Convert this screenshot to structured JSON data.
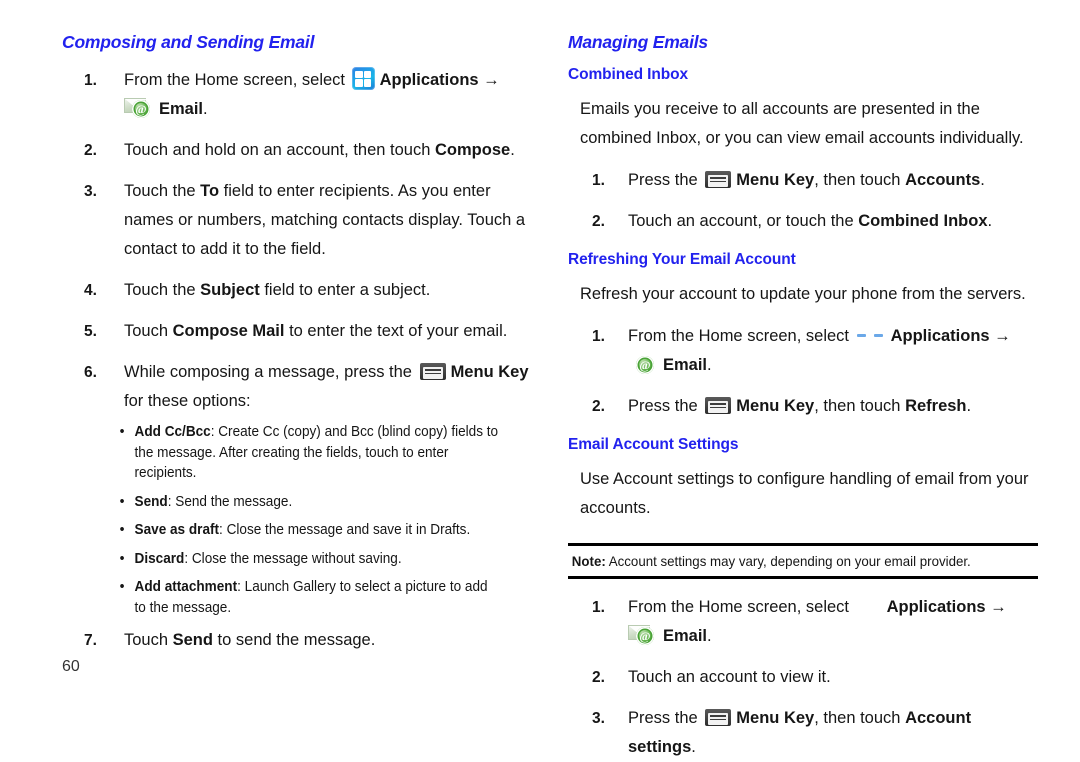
{
  "page_number": "60",
  "colors": {
    "heading_blue": "#2222ee",
    "body_text": "#161616",
    "rule_black": "#000000"
  },
  "icons": {
    "applications": "applications-grid-icon",
    "applications_faded": "applications-grid-icon-faded",
    "applications_missing": "applications-grid-icon-missing",
    "email": "email-envelope-at-icon",
    "email_no_envelope": "email-at-icon",
    "menu_key": "menu-key-icon",
    "arrow": "→",
    "bullet": "•"
  },
  "left_column": {
    "section_title": "Composing and Sending Email",
    "steps": [
      {
        "num": "1.",
        "pre": "From the Home screen, select ",
        "app_label": "Applications",
        "mid": "",
        "email_label": "Email",
        "post": "."
      },
      {
        "num": "2.",
        "pre": "Touch and hold on an account, then touch ",
        "bold": "Compose",
        "post": "."
      },
      {
        "num": "3.",
        "pre": "Touch the ",
        "bold": "To",
        "post": " field to enter recipients. As you enter names or numbers, matching contacts display. Touch a contact to add it to the field."
      },
      {
        "num": "4.",
        "pre": "Touch the ",
        "bold": "Subject",
        "post": " field to enter a subject."
      },
      {
        "num": "5.",
        "pre": "Touch ",
        "bold": "Compose Mail",
        "post": " to enter the text of your email."
      },
      {
        "num": "6.",
        "pre": "While composing a message, press the ",
        "bold": "Menu Key",
        "post": " for these options:"
      },
      {
        "num": "7.",
        "pre": "Touch ",
        "bold": "Send",
        "post": " to send the message."
      }
    ],
    "bullets": [
      {
        "term": "Add Cc/Bcc",
        "desc": ": Create Cc (copy) and Bcc (blind copy) fields to the message. After creating the fields, touch to enter recipients."
      },
      {
        "term": "Send",
        "desc": ": Send the message."
      },
      {
        "term": "Save as draft",
        "desc": ": Close the message and save it in Drafts."
      },
      {
        "term": "Discard",
        "desc": ": Close the message without saving."
      },
      {
        "term": "Add attachment",
        "desc": ": Launch Gallery to select a picture to add to the message."
      }
    ]
  },
  "right_column": {
    "section_title": "Managing Emails",
    "combined_inbox": {
      "sub_title": "Combined Inbox",
      "paragraph": "Emails you receive to all accounts are presented in the combined Inbox, or you can view email accounts individually.",
      "steps": [
        {
          "num": "1.",
          "pre": "Press the ",
          "bold": "Menu Key",
          "mid": ", then touch ",
          "bold2": "Accounts",
          "post": "."
        },
        {
          "num": "2.",
          "pre": "Touch an account, or touch the ",
          "bold": "Combined Inbox",
          "post": "."
        }
      ]
    },
    "refreshing": {
      "sub_title": "Refreshing Your Email Account",
      "paragraph": "Refresh your account to update your phone from the servers.",
      "steps": [
        {
          "num": "1.",
          "pre": "From the Home screen, select ",
          "app_label": "Applications",
          "email_label": "Email",
          "post": "."
        },
        {
          "num": "2.",
          "pre": "Press the ",
          "bold": "Menu Key",
          "mid": ", then touch ",
          "bold2": "Refresh",
          "post": "."
        }
      ]
    },
    "account_settings": {
      "sub_title": "Email Account Settings",
      "paragraph": "Use Account settings to configure handling of email from your accounts.",
      "note_label": "Note:",
      "note_text": " Account settings may vary, depending on your email provider.",
      "steps": [
        {
          "num": "1.",
          "pre": "From the Home screen, select ",
          "app_label": "Applications",
          "email_label": "Email",
          "post": "."
        },
        {
          "num": "2.",
          "pre": "Touch an account to view it.",
          "bold": "",
          "post": ""
        },
        {
          "num": "3.",
          "pre": "Press the ",
          "bold": "Menu Key",
          "mid": ", then touch ",
          "bold2": "Account settings",
          "post": "."
        }
      ]
    }
  }
}
